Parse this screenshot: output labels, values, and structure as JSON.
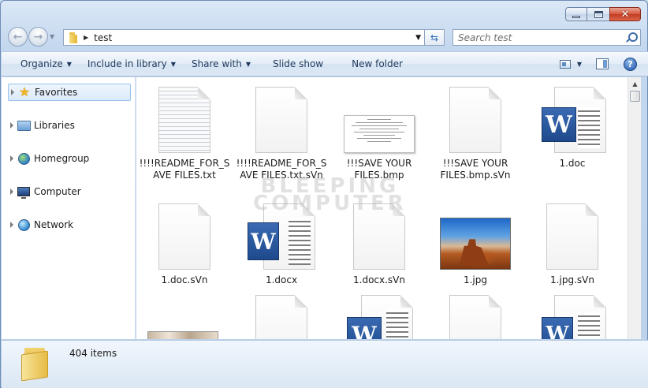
{
  "window": {
    "caption": {
      "minimize": "minimize",
      "maximize": "maximize",
      "close": "close"
    }
  },
  "address": {
    "path": "test",
    "search_placeholder": "Search test"
  },
  "toolbar": {
    "organize": "Organize",
    "include_in_library": "Include in library",
    "share_with": "Share with",
    "slide_show": "Slide show",
    "new_folder": "New folder"
  },
  "nav": {
    "items": [
      {
        "label": "Favorites",
        "icon": "star-icon",
        "selected": true
      },
      {
        "label": "Libraries",
        "icon": "libraries-icon"
      },
      {
        "label": "Homegroup",
        "icon": "homegroup-icon"
      },
      {
        "label": "Computer",
        "icon": "computer-icon"
      },
      {
        "label": "Network",
        "icon": "network-icon"
      }
    ]
  },
  "files": {
    "row1": [
      {
        "name": "!!!!README_FOR_SAVE FILES.txt",
        "type": "txt"
      },
      {
        "name": "!!!!README_FOR_SAVE FILES.txt.sVn",
        "type": "blank"
      },
      {
        "name": "!!!SAVE YOUR FILES.bmp",
        "type": "bmp"
      },
      {
        "name": "!!!SAVE YOUR FILES.bmp.sVn",
        "type": "blank"
      },
      {
        "name": "1.doc",
        "type": "word"
      }
    ],
    "row2": [
      {
        "name": "1.doc.sVn",
        "type": "blank"
      },
      {
        "name": "1.docx",
        "type": "word"
      },
      {
        "name": "1.docx.sVn",
        "type": "blank"
      },
      {
        "name": "1.jpg",
        "type": "jpg"
      },
      {
        "name": "1.jpg.sVn",
        "type": "blank"
      }
    ]
  },
  "watermark": {
    "line1": "BLEEPING",
    "line2": "COMPUTER"
  },
  "details": {
    "item_count": "404 items"
  },
  "icons": {
    "back": "back-arrow-icon",
    "forward": "forward-arrow-icon",
    "folder": "folder-icon",
    "refresh": "refresh-icon",
    "search": "search-icon",
    "views": "views-icon",
    "preview_pane": "preview-pane-icon",
    "help": "help-icon"
  },
  "colors": {
    "chrome": "#c3d7ee",
    "selection": "#dbeafb",
    "close_button": "#c23c22",
    "word_blue": "#1e4a8c"
  }
}
